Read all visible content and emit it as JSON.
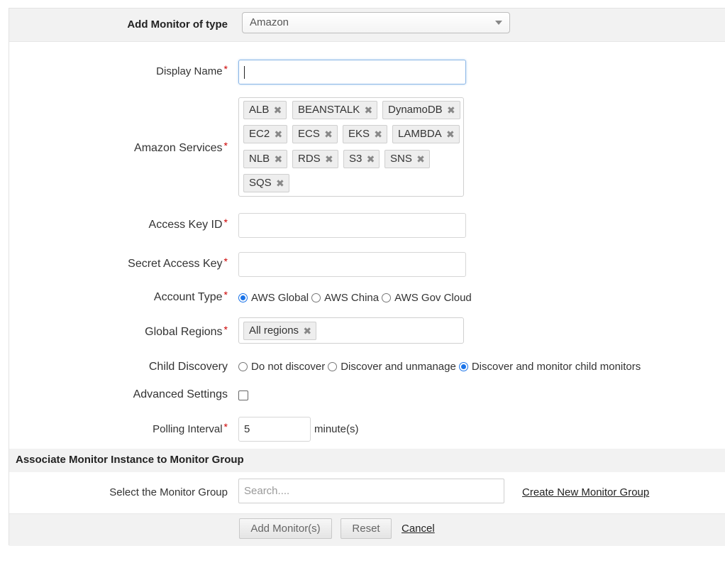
{
  "header": {
    "label": "Add Monitor of type",
    "selected_type": "Amazon"
  },
  "form": {
    "display_name": {
      "label": "Display Name",
      "required": "*",
      "value": ""
    },
    "amazon_services": {
      "label": "Amazon Services",
      "required": "*",
      "tags": [
        "ALB",
        "BEANSTALK",
        "DynamoDB",
        "EC2",
        "ECS",
        "EKS",
        "LAMBDA",
        "NLB",
        "RDS",
        "S3",
        "SNS",
        "SQS"
      ]
    },
    "access_key_id": {
      "label": "Access Key ID",
      "required": "*",
      "value": ""
    },
    "secret_access_key": {
      "label": "Secret Access Key",
      "required": "*",
      "value": ""
    },
    "account_type": {
      "label": "Account Type",
      "required": "*",
      "options": [
        "AWS Global",
        "AWS China",
        "AWS Gov Cloud"
      ],
      "selected": "AWS Global"
    },
    "global_regions": {
      "label": "Global Regions",
      "required": "*",
      "tags": [
        "All regions"
      ]
    },
    "child_discovery": {
      "label": "Child Discovery",
      "options": [
        "Do not discover",
        "Discover and unmanage",
        "Discover and monitor child monitors"
      ],
      "selected": "Discover and monitor child monitors"
    },
    "advanced_settings": {
      "label": "Advanced Settings",
      "checked": false
    },
    "polling_interval": {
      "label": "Polling Interval",
      "required": "*",
      "value": "5",
      "unit": "minute(s)"
    }
  },
  "associate": {
    "heading": "Associate Monitor Instance to Monitor Group",
    "select_label": "Select the Monitor Group",
    "search_placeholder": "Search....",
    "create_link": "Create New Monitor Group"
  },
  "actions": {
    "add": "Add Monitor(s)",
    "reset": "Reset",
    "cancel": "Cancel"
  },
  "colors": {
    "required": "#cc0000",
    "radio_selected": "#1a73e8",
    "band_background": "#f2f2f2"
  }
}
